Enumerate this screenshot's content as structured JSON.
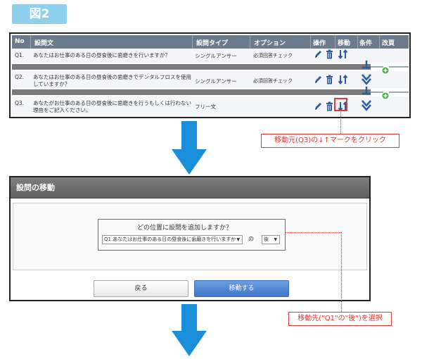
{
  "figure_label": "図2",
  "table": {
    "headers": [
      "No",
      "設問文",
      "設問タイプ",
      "オプション",
      "操作",
      "移動",
      "条件",
      "改頁"
    ],
    "rows": [
      {
        "no": "Q1.",
        "text": "あなたはお仕事のある日の昼食後に歯磨きを行いますか？",
        "type": "シングルアンサー",
        "option": "必須回答チェック"
      },
      {
        "no": "Q2.",
        "text": "あなたはお仕事のある日の昼食後の歯磨きでデンタルフロスを使用していますか？",
        "type": "シングルアンサー",
        "option": "必須回答チェック"
      },
      {
        "no": "Q3.",
        "text": "あなたがお仕事のある日の昼食後に歯磨きを行うもしくは行わない理由をご記入ください。",
        "type": "フリー文",
        "option": ""
      }
    ]
  },
  "callout1": "移動元(Q3)の↓↑マークをクリック",
  "dialog": {
    "title": "設問の移動",
    "prompt": "どの位置に設問を追加しますか？",
    "question_select_value": "Q1.あなたはお仕事のある日の昼食後に歯磨きを行いますか",
    "no_label": "の",
    "position_select_value": "後",
    "back_button": "戻る",
    "move_button": "移動する"
  },
  "callout2": "移動先(\"Q1\"の\"後\")を選択",
  "colors": {
    "accent_blue": "#1a8fd9",
    "highlight_red": "#e53935",
    "header_gray": "#6c7b8c"
  }
}
